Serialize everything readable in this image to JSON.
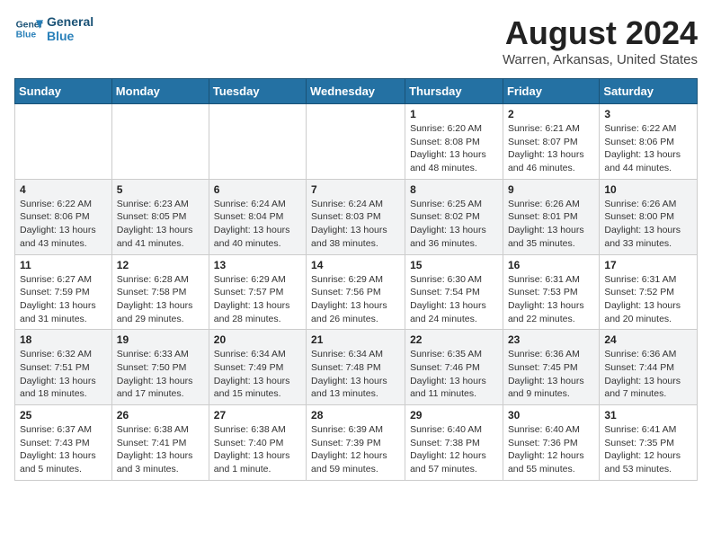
{
  "header": {
    "logo_line1": "General",
    "logo_line2": "Blue",
    "month_year": "August 2024",
    "location": "Warren, Arkansas, United States"
  },
  "weekdays": [
    "Sunday",
    "Monday",
    "Tuesday",
    "Wednesday",
    "Thursday",
    "Friday",
    "Saturday"
  ],
  "weeks": [
    [
      {
        "day": "",
        "info": ""
      },
      {
        "day": "",
        "info": ""
      },
      {
        "day": "",
        "info": ""
      },
      {
        "day": "",
        "info": ""
      },
      {
        "day": "1",
        "info": "Sunrise: 6:20 AM\nSunset: 8:08 PM\nDaylight: 13 hours\nand 48 minutes."
      },
      {
        "day": "2",
        "info": "Sunrise: 6:21 AM\nSunset: 8:07 PM\nDaylight: 13 hours\nand 46 minutes."
      },
      {
        "day": "3",
        "info": "Sunrise: 6:22 AM\nSunset: 8:06 PM\nDaylight: 13 hours\nand 44 minutes."
      }
    ],
    [
      {
        "day": "4",
        "info": "Sunrise: 6:22 AM\nSunset: 8:06 PM\nDaylight: 13 hours\nand 43 minutes."
      },
      {
        "day": "5",
        "info": "Sunrise: 6:23 AM\nSunset: 8:05 PM\nDaylight: 13 hours\nand 41 minutes."
      },
      {
        "day": "6",
        "info": "Sunrise: 6:24 AM\nSunset: 8:04 PM\nDaylight: 13 hours\nand 40 minutes."
      },
      {
        "day": "7",
        "info": "Sunrise: 6:24 AM\nSunset: 8:03 PM\nDaylight: 13 hours\nand 38 minutes."
      },
      {
        "day": "8",
        "info": "Sunrise: 6:25 AM\nSunset: 8:02 PM\nDaylight: 13 hours\nand 36 minutes."
      },
      {
        "day": "9",
        "info": "Sunrise: 6:26 AM\nSunset: 8:01 PM\nDaylight: 13 hours\nand 35 minutes."
      },
      {
        "day": "10",
        "info": "Sunrise: 6:26 AM\nSunset: 8:00 PM\nDaylight: 13 hours\nand 33 minutes."
      }
    ],
    [
      {
        "day": "11",
        "info": "Sunrise: 6:27 AM\nSunset: 7:59 PM\nDaylight: 13 hours\nand 31 minutes."
      },
      {
        "day": "12",
        "info": "Sunrise: 6:28 AM\nSunset: 7:58 PM\nDaylight: 13 hours\nand 29 minutes."
      },
      {
        "day": "13",
        "info": "Sunrise: 6:29 AM\nSunset: 7:57 PM\nDaylight: 13 hours\nand 28 minutes."
      },
      {
        "day": "14",
        "info": "Sunrise: 6:29 AM\nSunset: 7:56 PM\nDaylight: 13 hours\nand 26 minutes."
      },
      {
        "day": "15",
        "info": "Sunrise: 6:30 AM\nSunset: 7:54 PM\nDaylight: 13 hours\nand 24 minutes."
      },
      {
        "day": "16",
        "info": "Sunrise: 6:31 AM\nSunset: 7:53 PM\nDaylight: 13 hours\nand 22 minutes."
      },
      {
        "day": "17",
        "info": "Sunrise: 6:31 AM\nSunset: 7:52 PM\nDaylight: 13 hours\nand 20 minutes."
      }
    ],
    [
      {
        "day": "18",
        "info": "Sunrise: 6:32 AM\nSunset: 7:51 PM\nDaylight: 13 hours\nand 18 minutes."
      },
      {
        "day": "19",
        "info": "Sunrise: 6:33 AM\nSunset: 7:50 PM\nDaylight: 13 hours\nand 17 minutes."
      },
      {
        "day": "20",
        "info": "Sunrise: 6:34 AM\nSunset: 7:49 PM\nDaylight: 13 hours\nand 15 minutes."
      },
      {
        "day": "21",
        "info": "Sunrise: 6:34 AM\nSunset: 7:48 PM\nDaylight: 13 hours\nand 13 minutes."
      },
      {
        "day": "22",
        "info": "Sunrise: 6:35 AM\nSunset: 7:46 PM\nDaylight: 13 hours\nand 11 minutes."
      },
      {
        "day": "23",
        "info": "Sunrise: 6:36 AM\nSunset: 7:45 PM\nDaylight: 13 hours\nand 9 minutes."
      },
      {
        "day": "24",
        "info": "Sunrise: 6:36 AM\nSunset: 7:44 PM\nDaylight: 13 hours\nand 7 minutes."
      }
    ],
    [
      {
        "day": "25",
        "info": "Sunrise: 6:37 AM\nSunset: 7:43 PM\nDaylight: 13 hours\nand 5 minutes."
      },
      {
        "day": "26",
        "info": "Sunrise: 6:38 AM\nSunset: 7:41 PM\nDaylight: 13 hours\nand 3 minutes."
      },
      {
        "day": "27",
        "info": "Sunrise: 6:38 AM\nSunset: 7:40 PM\nDaylight: 13 hours\nand 1 minute."
      },
      {
        "day": "28",
        "info": "Sunrise: 6:39 AM\nSunset: 7:39 PM\nDaylight: 12 hours\nand 59 minutes."
      },
      {
        "day": "29",
        "info": "Sunrise: 6:40 AM\nSunset: 7:38 PM\nDaylight: 12 hours\nand 57 minutes."
      },
      {
        "day": "30",
        "info": "Sunrise: 6:40 AM\nSunset: 7:36 PM\nDaylight: 12 hours\nand 55 minutes."
      },
      {
        "day": "31",
        "info": "Sunrise: 6:41 AM\nSunset: 7:35 PM\nDaylight: 12 hours\nand 53 minutes."
      }
    ]
  ]
}
